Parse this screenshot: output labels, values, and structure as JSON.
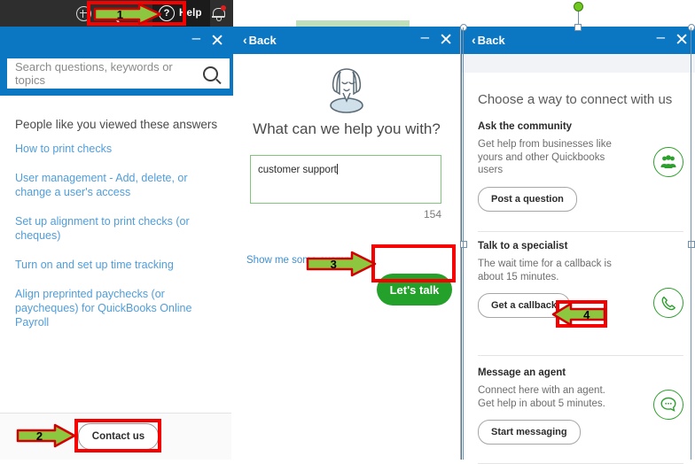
{
  "app_bar": {
    "icons": [
      "plus-icon",
      "search-icon",
      "help-icon",
      "bell-icon"
    ],
    "help_label": "Help"
  },
  "left_panel": {
    "search": {
      "placeholder": "Search questions, keywords or topics"
    },
    "section_title": "People like you viewed these answers",
    "links": [
      "How to print checks",
      "User management - Add, delete, or change a user's access",
      "Set up alignment to print checks (or cheques)",
      "Turn on and set up time tracking",
      "Align preprinted paychecks (or paycheques) for QuickBooks Online Payroll"
    ],
    "contact_button": "Contact us",
    "minimize": "–",
    "close": "✕"
  },
  "mid_panel": {
    "back_label": "Back",
    "heading": "What can we help you with?",
    "textarea_value": "customer support",
    "char_count": "154",
    "examples_link": "Show me some examples",
    "cta_button": "Let's talk",
    "minimize": "–",
    "close": "✕"
  },
  "right_panel": {
    "back_label": "Back",
    "title": "Choose a way to connect with us",
    "sections": [
      {
        "heading": "Ask the community",
        "body": "Get help from businesses like yours and other Quickbooks users",
        "button": "Post a question",
        "icon": "community-people-icon"
      },
      {
        "heading": "Talk to a specialist",
        "body": "The wait time for a callback is about 15 minutes.",
        "button": "Get a callback",
        "icon": "phone-handset-icon"
      },
      {
        "heading": "Message an agent",
        "body": "Connect here with an agent. Get help in about 5 minutes.",
        "button": "Start messaging",
        "icon": "chat-bubble-icon"
      }
    ],
    "minimize": "–",
    "close": "✕"
  },
  "annotations": {
    "step1": "1",
    "step2": "2",
    "step3": "3",
    "step4": "4"
  },
  "colors": {
    "brand_blue": "#0b77c2",
    "accent_green": "#23a12a",
    "annotation_red": "#f60000",
    "arrow_green": "#8dc63f",
    "link_blue": "#4f9ddb"
  }
}
